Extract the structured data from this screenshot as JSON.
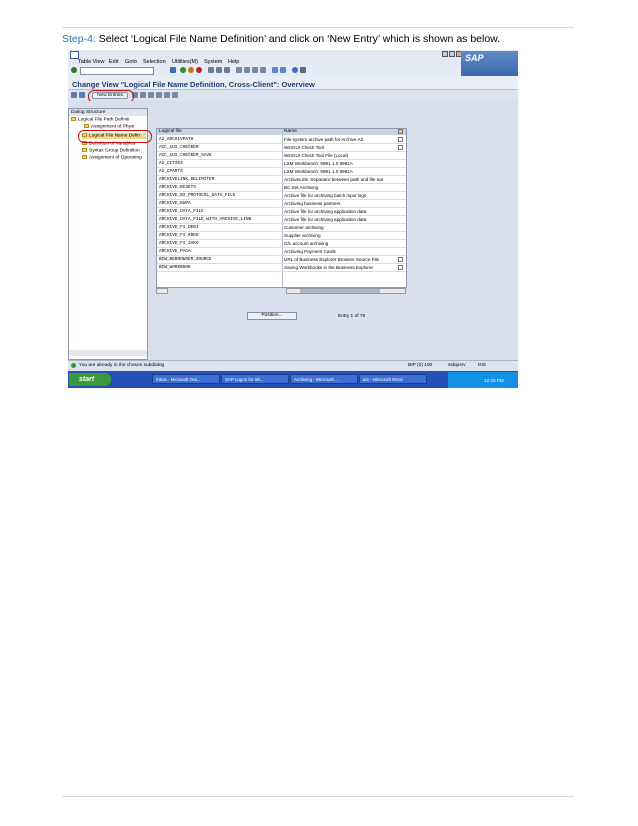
{
  "instruction": {
    "step_label": "Step-4:",
    "text": " Select ‘Logical File Name Definition’ and click on ‘New Entry’ which is shown as below."
  },
  "sap": {
    "menu": [
      "Table View",
      "Edit",
      "Goto",
      "Selection",
      "Utilities(M)",
      "System",
      "Help"
    ],
    "logo_text": "SAP",
    "title": "Change View \"Logical File Name Definition, Cross-Client\": Overview",
    "new_entries_label": "New Entries",
    "dialog_structure": {
      "heading": "Dialog Structure",
      "items": [
        "Logical File Path Definiti",
        "Assignment of Physi",
        "Logical File Name Defin",
        "Definition of Variables",
        "Syntax Group Definition",
        "Assignment of Operating"
      ]
    },
    "table": {
      "columns": [
        "Logical file",
        "Name"
      ],
      "rows": [
        [
          "A2_ARCHIVPATH",
          "File system archive path for Archive A2"
        ],
        [
          "ACC_GUI_CHECKER",
          "WinGUI Check Tool"
        ],
        [
          "ACC_GUI_CHECKER_SAVE",
          "WinGUI Check Tool File (Local)"
        ],
        [
          "AS_CITIES",
          "LSM Workbench: 9991 1.0 9991A"
        ],
        [
          "AS_CPARTS",
          "LSM Workbench: 9991 1.0 9991A"
        ],
        [
          "ARCHIVELINK_DELIMITER",
          "ArchiveLink: Separator between path and file nar"
        ],
        [
          "ARCHIVE_BCSETS",
          "BC Set Archiving"
        ],
        [
          "ARCHIVE_BI_PROTOCOL_DATA_FILE",
          "Archive file for archiving batch input logs"
        ],
        [
          "ARCHIVE_BUPA",
          "Archiving business partners"
        ],
        [
          "ARCHIVE_DATA_FILE",
          "Archive file for archiving application data"
        ],
        [
          "ARCHIVE_DATA_FILE_WITH_ARCHIVE_LINK",
          "Archive file for archiving application data"
        ],
        [
          "ARCHIVE_FI_DEBI",
          "Customer archiving"
        ],
        [
          "ARCHIVE_FI_KRED",
          "Supplier archiving"
        ],
        [
          "ARCHIVE_FI_SAKO",
          "G/L account archiving"
        ],
        [
          "ARCHIVE_PACA",
          "Archiving Payment Cards"
        ],
        [
          "BIW_BEBROWSER_SOURCE",
          "URL of Business Explorer Browser Source File"
        ],
        [
          "BIW_WORKBOOK",
          "Saving Workbooks in the Business Explorer"
        ]
      ]
    },
    "position_label": "Position...",
    "entry_text": "Entry 1 of 79",
    "status_message": "You are already in the chosen subdialog",
    "status_system": "BIP (2) 100",
    "status_server": "ssbipsrv",
    "status_mode": "INS"
  },
  "taskbar": {
    "start_label": "start",
    "tasks": [
      "Inbox - Microsoft Out...",
      "SAP Logon for Wi...",
      "Archiving - Microsoft ...",
      "arc - Microsoft Word"
    ],
    "clock": "12:33 PM"
  }
}
